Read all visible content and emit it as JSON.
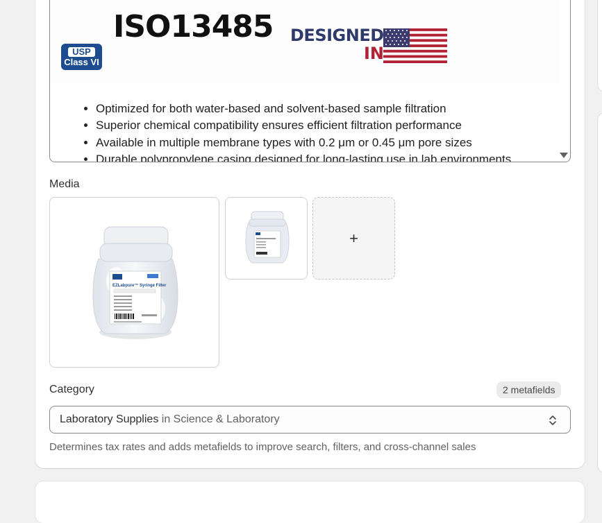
{
  "description_editor": {
    "logos": {
      "usp_line1": "USP",
      "usp_line2": "Class VI",
      "iso": "ISO13485",
      "designed_line1": "DESIGNED",
      "designed_line2": "IN"
    },
    "bullets": [
      "Optimized for both water-based and solvent-based sample filtration",
      "Superior chemical compatibility ensures efficient filtration performance",
      "Available in multiple membrane types with 0.2 μm or 0.45 μm pore sizes",
      "Durable polypropylene casing designed for long-lasting use in lab environments"
    ]
  },
  "media": {
    "label": "Media",
    "add_button": "+",
    "product_label": {
      "brand": "EZLabpure™ Syringe Filter"
    }
  },
  "category": {
    "label": "Category",
    "metafields_badge": "2 metafields",
    "selected_primary": "Laboratory Supplies",
    "selected_secondary": "in Science & Laboratory",
    "help_text": "Determines tax rates and adds metafields to improve search, filters, and cross-channel sales"
  },
  "colors": {
    "usp_blue": "#1d4d8f",
    "flag_red": "#b22234",
    "flag_blue": "#3c3b6e",
    "designed_navy": "#2f3a6b"
  }
}
